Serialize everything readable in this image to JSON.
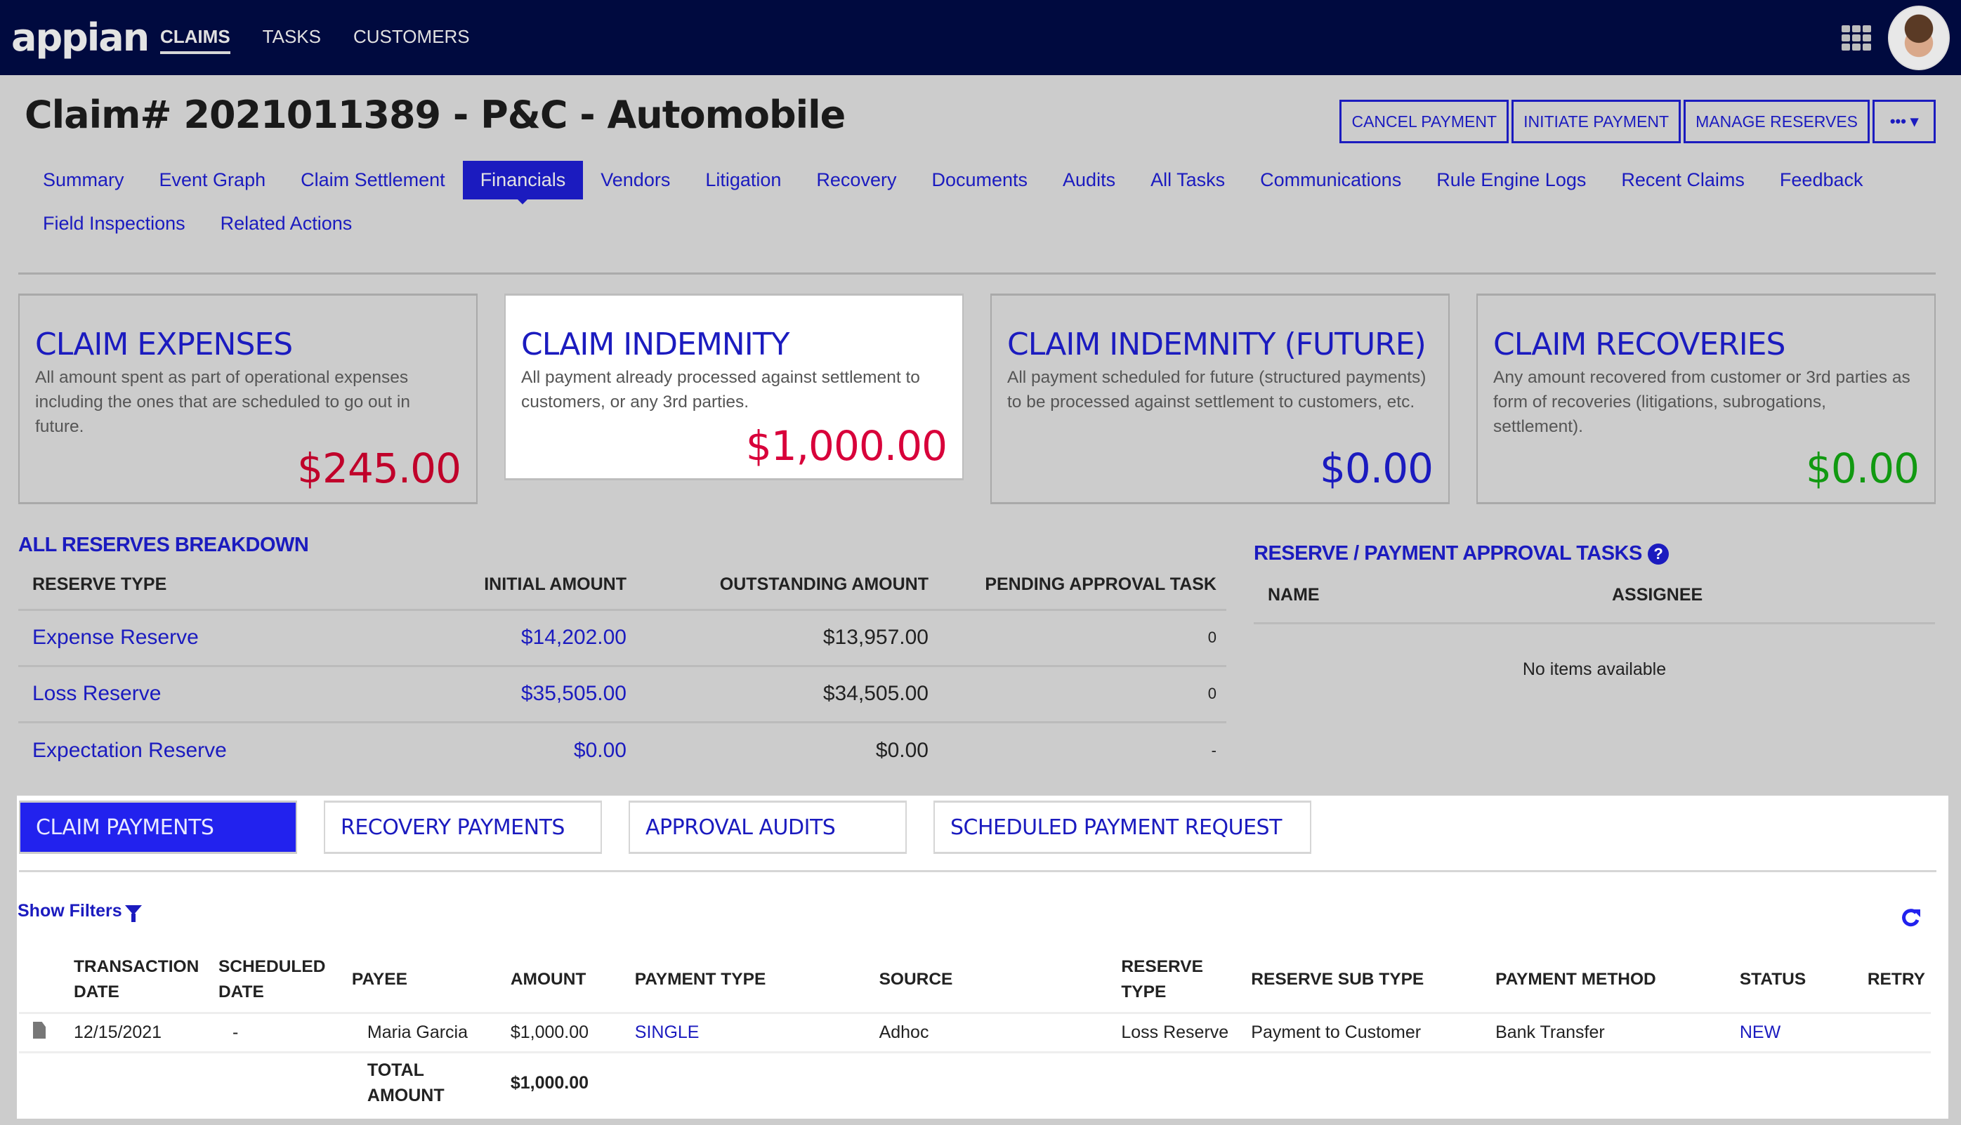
{
  "app": {
    "logo": "appian",
    "nav": [
      {
        "label": "CLAIMS",
        "active": true
      },
      {
        "label": "TASKS",
        "active": false
      },
      {
        "label": "CUSTOMERS",
        "active": false
      }
    ],
    "icons": {
      "apps": "grid-icon",
      "user": "avatar"
    }
  },
  "header": {
    "title": "Claim# 2021011389 - P&C - Automobile",
    "actions": [
      "CANCEL PAYMENT",
      "INITIATE PAYMENT",
      "MANAGE RESERVES"
    ],
    "more_label": "••• ▾"
  },
  "tabs": [
    {
      "label": "Summary"
    },
    {
      "label": "Event Graph"
    },
    {
      "label": "Claim Settlement"
    },
    {
      "label": "Financials",
      "active": true
    },
    {
      "label": "Vendors"
    },
    {
      "label": "Litigation"
    },
    {
      "label": "Recovery"
    },
    {
      "label": "Documents"
    },
    {
      "label": "Audits"
    },
    {
      "label": "All Tasks"
    },
    {
      "label": "Communications"
    },
    {
      "label": "Rule Engine Logs"
    },
    {
      "label": "Recent Claims"
    },
    {
      "label": "Feedback"
    },
    {
      "label": "Field Inspections"
    },
    {
      "label": "Related Actions"
    }
  ],
  "cards": [
    {
      "title": "CLAIM EXPENSES",
      "description": "All amount spent as part of operational expenses including the ones that are scheduled to go out in future.",
      "value": "$245.00",
      "value_color": "#c0002a"
    },
    {
      "title": "CLAIM INDEMNITY",
      "description": "All payment already processed against settlement to customers, or any 3rd parties.",
      "value": "$1,000.00",
      "value_color": "#d8003a",
      "selected": true
    },
    {
      "title": "CLAIM INDEMNITY (FUTURE)",
      "description": "All payment scheduled for future (structured payments) to be processed  against settlement to customers, etc.",
      "value": "$0.00",
      "value_color": "#1b1bbf"
    },
    {
      "title": "CLAIM RECOVERIES",
      "description": "Any amount recovered from customer or 3rd parties as form of recoveries (litigations, subrogations, settlement).",
      "value": "$0.00",
      "value_color": "#119911"
    }
  ],
  "reserves": {
    "title": "ALL RESERVES BREAKDOWN",
    "columns": [
      "RESERVE TYPE",
      "INITIAL AMOUNT",
      "OUTSTANDING AMOUNT",
      "PENDING APPROVAL TASK"
    ],
    "rows": [
      {
        "type": "Expense Reserve",
        "initial": "$14,202.00",
        "outstanding": "$13,957.00",
        "pending": "0"
      },
      {
        "type": "Loss Reserve",
        "initial": "$35,505.00",
        "outstanding": "$34,505.00",
        "pending": "0"
      },
      {
        "type": "Expectation Reserve",
        "initial": "$0.00",
        "outstanding": "$0.00",
        "pending": "-"
      }
    ]
  },
  "approval_tasks": {
    "title": "RESERVE / PAYMENT APPROVAL TASKS",
    "help_icon": "?",
    "columns": [
      "NAME",
      "ASSIGNEE"
    ],
    "empty_text": "No items available"
  },
  "payments": {
    "tabs": [
      {
        "label": "CLAIM PAYMENTS",
        "active": true
      },
      {
        "label": "RECOVERY PAYMENTS"
      },
      {
        "label": "APPROVAL AUDITS"
      },
      {
        "label": "SCHEDULED PAYMENT REQUEST"
      }
    ],
    "show_filters": "Show Filters",
    "columns": [
      "",
      "TRANSACTION DATE",
      "SCHEDULED DATE",
      "PAYEE",
      "AMOUNT",
      "PAYMENT TYPE",
      "SOURCE",
      "RESERVE TYPE",
      "RESERVE SUB TYPE",
      "PAYMENT METHOD",
      "STATUS",
      "RETRY"
    ],
    "rows": [
      {
        "icon": "document-icon",
        "transaction_date": "12/15/2021",
        "scheduled_date": "-",
        "payee": "Maria Garcia",
        "amount": "$1,000.00",
        "payment_type": "SINGLE",
        "source": "Adhoc",
        "reserve_type": "Loss Reserve",
        "reserve_sub_type": "Payment to Customer",
        "payment_method": "Bank Transfer",
        "status": "NEW",
        "retry": ""
      }
    ],
    "total_label": "TOTAL AMOUNT",
    "total_value": "$1,000.00"
  },
  "colors": {
    "accent": "#1b1bbf",
    "topbar": "#000a3f",
    "background": "#cccccc",
    "active_tab": "#2222ee"
  }
}
